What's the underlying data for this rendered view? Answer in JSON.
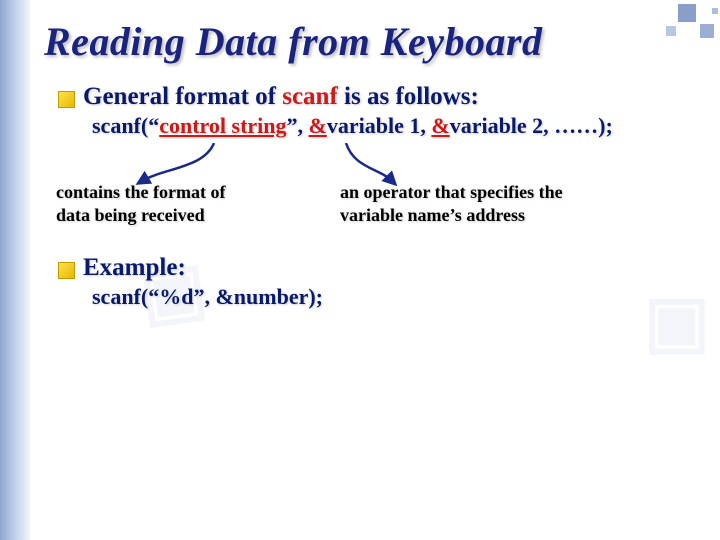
{
  "title": "Reading Data from Keyboard",
  "bullet1": {
    "prefix": "General format of ",
    "fn": "scanf",
    "suffix": " is as follows:"
  },
  "code1": {
    "head": "scanf(“",
    "ctrl": "control string",
    "mid1": "”, ",
    "amp1": "&",
    "v1": "variable 1, ",
    "amp2": "&",
    "v2": "variable 2, ……);"
  },
  "callout_left_l1": "contains the format of",
  "callout_left_l2": "data being received",
  "callout_right_l1": "an operator that specifies the",
  "callout_right_l2": "variable name’s address",
  "bullet2": "Example:",
  "code2": {
    "head": "scanf(“%d”, ",
    "amp": "&",
    "tail": "number);"
  }
}
